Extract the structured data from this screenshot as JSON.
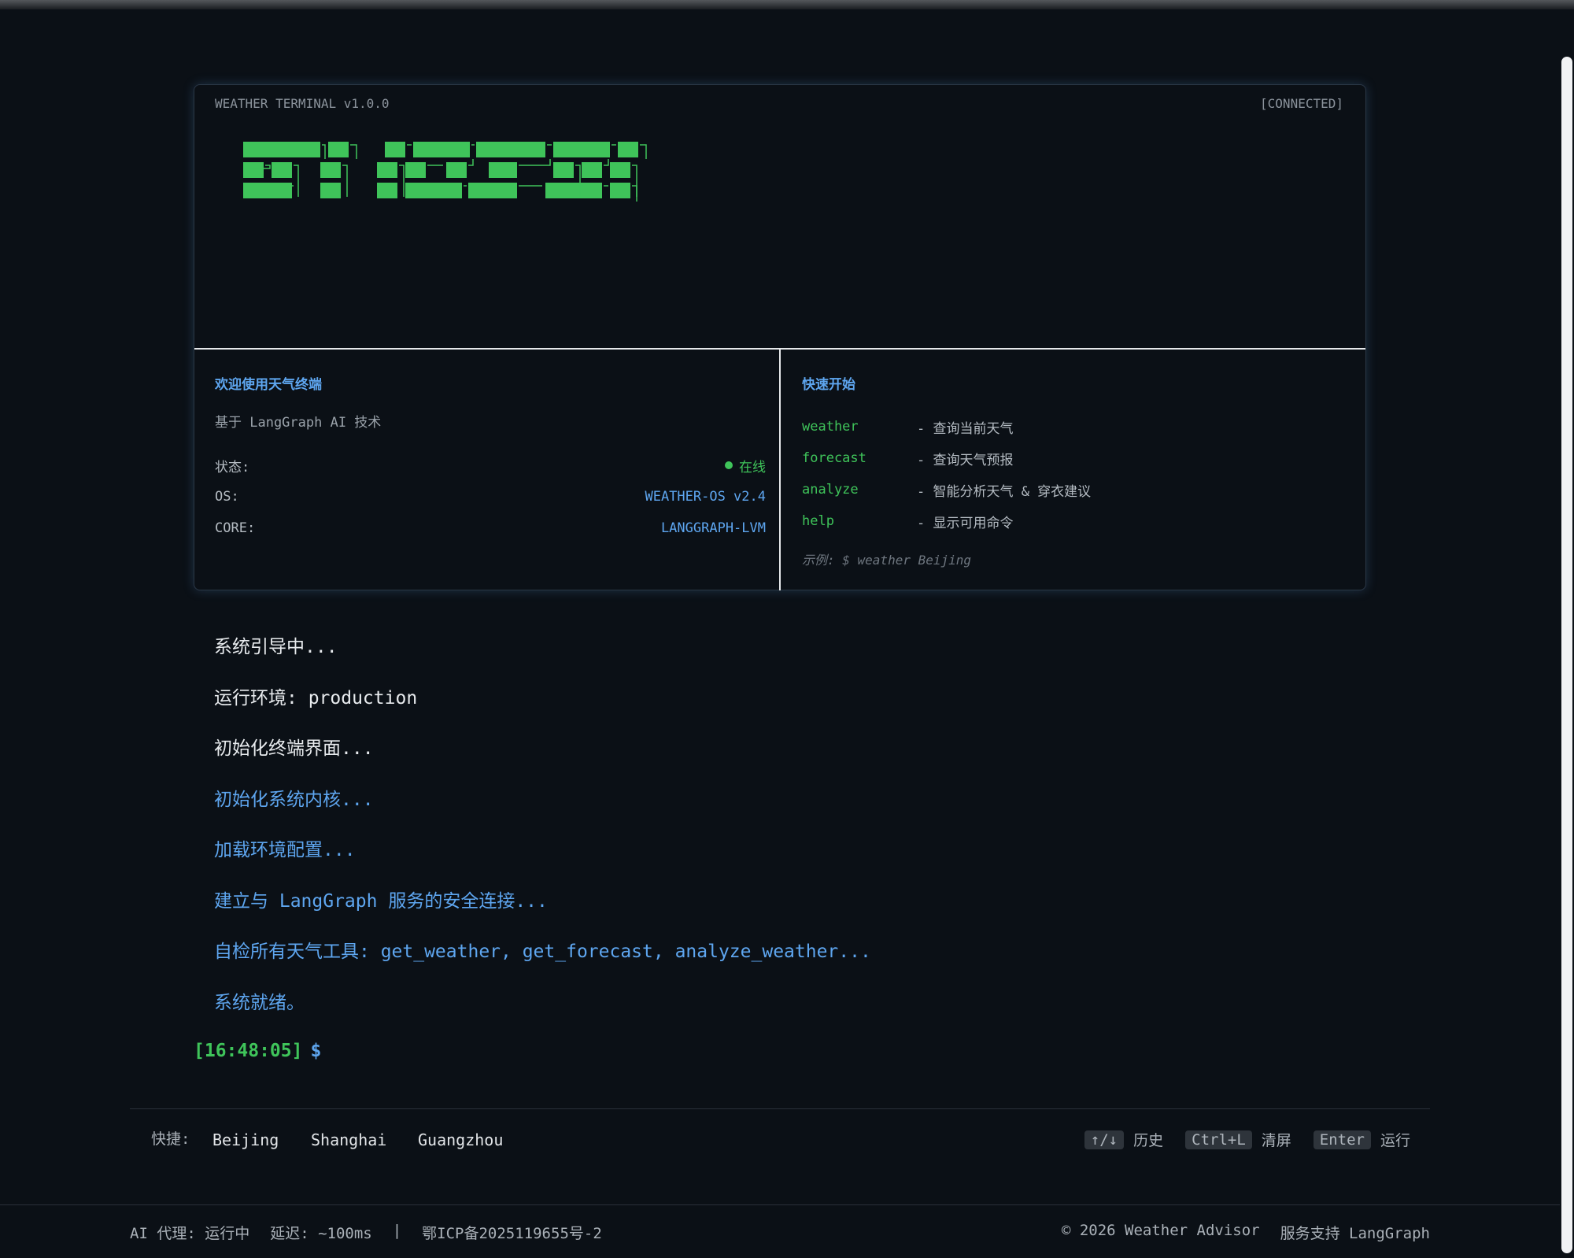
{
  "panel": {
    "title": "WEATHER TERMINAL v1.0.0",
    "status": "[CONNECTED]",
    "logo_icon": "ascii-art-logo",
    "accent_green": "#3fc45a",
    "accent_blue": "#5ea6f0"
  },
  "welcome": {
    "title": "欢迎使用天气终端",
    "subtitle": "基于 LangGraph AI 技术",
    "rows": [
      {
        "key": "状态:",
        "value": "在线"
      },
      {
        "key": "OS:",
        "value": "WEATHER-OS v2.4"
      },
      {
        "key": "CORE:",
        "value": "LANGGRAPH-LVM"
      }
    ]
  },
  "quickstart": {
    "title": "快速开始",
    "commands": [
      {
        "cmd": "weather",
        "desc": "- 查询当前天气"
      },
      {
        "cmd": "forecast",
        "desc": "- 查询天气预报"
      },
      {
        "cmd": "analyze",
        "desc": "- 智能分析天气 & 穿衣建议"
      },
      {
        "cmd": "help",
        "desc": "- 显示可用命令"
      }
    ],
    "example": "示例: $ weather Beijing"
  },
  "log": [
    "系统引导中...",
    "运行环境: production",
    "初始化终端界面...",
    "初始化系统内核...",
    "加载环境配置...",
    "建立与 LangGraph 服务的安全连接...",
    "自检所有天气工具: get_weather, get_forecast, analyze_weather...",
    "系统就绪。"
  ],
  "prompt": {
    "time": "[16:48:05]",
    "symbol": "$"
  },
  "quickbar": {
    "label": "快捷:",
    "cities": [
      "Beijing",
      "Shanghai",
      "Guangzhou"
    ],
    "shortcuts": [
      {
        "key": "↑/↓",
        "label": "历史"
      },
      {
        "key": "Ctrl+L",
        "label": "清屏"
      },
      {
        "key": "Enter",
        "label": "运行"
      }
    ]
  },
  "footer": {
    "agent": "AI 代理: 运行中",
    "latency": "延迟: ~100ms",
    "sep": "|",
    "icp": "鄂ICP备2025119655号-2",
    "copyright": "© 2026 Weather Advisor",
    "support": "服务支持 LangGraph"
  }
}
